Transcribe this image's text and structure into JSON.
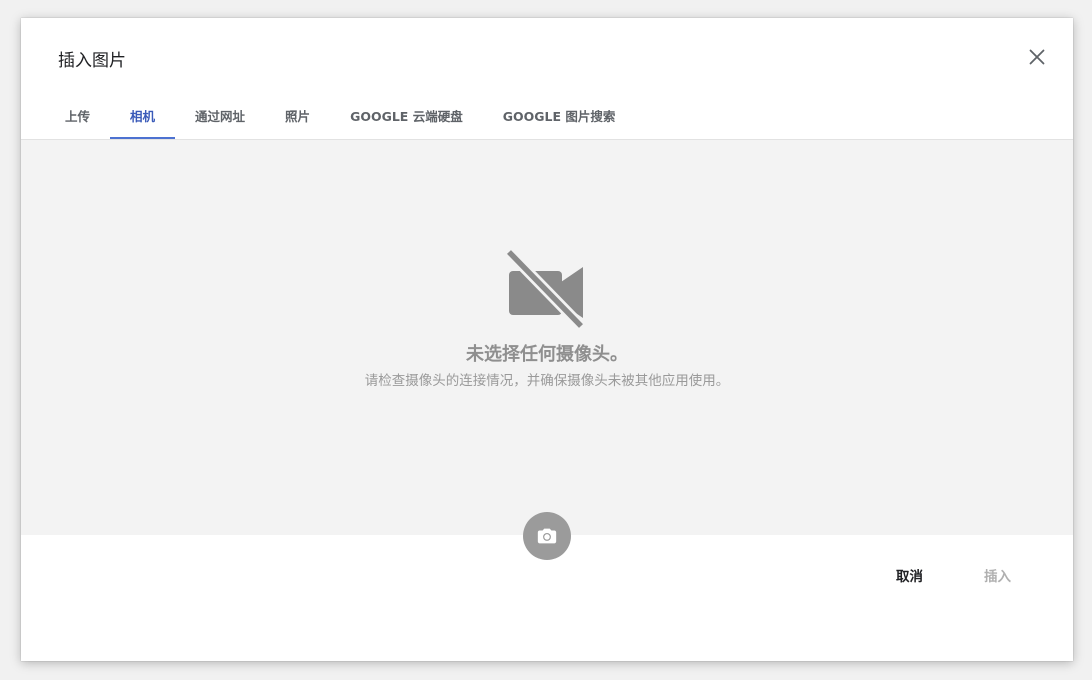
{
  "dialog": {
    "title": "插入图片",
    "close_icon": "close-icon"
  },
  "tabs": [
    {
      "label": "上传",
      "active": false
    },
    {
      "label": "相机",
      "active": true
    },
    {
      "label": "通过网址",
      "active": false
    },
    {
      "label": "照片",
      "active": false
    },
    {
      "label": "GOOGLE 云端硬盘",
      "active": false
    },
    {
      "label": "GOOGLE 图片搜索",
      "active": false
    }
  ],
  "camera": {
    "icon": "videocam-off-icon",
    "message_title": "未选择任何摄像头。",
    "message_detail": "请检查摄像头的连接情况，并确保摄像头未被其他应用使用。",
    "capture_icon": "camera-icon"
  },
  "footer": {
    "cancel_label": "取消",
    "insert_label": "插入",
    "insert_enabled": false
  },
  "colors": {
    "accent": "#4d72d1",
    "active_tab_text": "#3b5bb9",
    "camera_area_bg": "#f3f3f3",
    "icon_gray": "#8a8a8a",
    "shutter_bg": "#9b9b9b"
  }
}
